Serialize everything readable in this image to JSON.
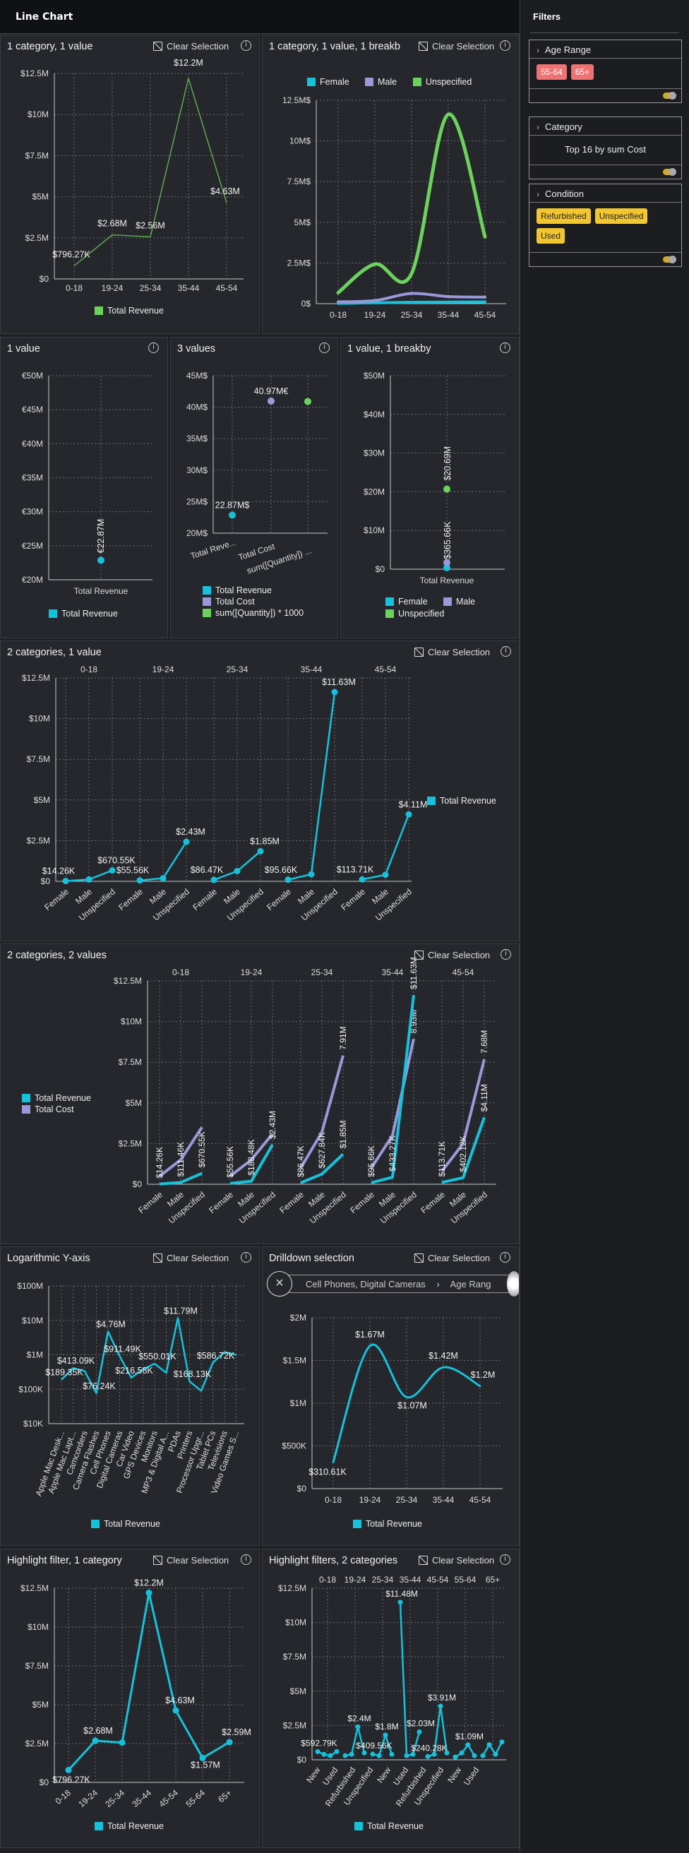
{
  "app": {
    "title": "Line Chart",
    "clear_label": "Clear Selection"
  },
  "panels": {
    "p1": {
      "title": "1 category, 1 value"
    },
    "p2": {
      "title": "1 category, 1 value, 1 breakb"
    },
    "p3": {
      "title": "1 value"
    },
    "p4": {
      "title": "3 values"
    },
    "p5": {
      "title": "1 value, 1 breakby"
    },
    "p6": {
      "title": "2 categories, 1 value"
    },
    "p7": {
      "title": "2 categories, 2 values"
    },
    "p8": {
      "title": "Logarithmic Y-axis"
    },
    "p9": {
      "title": "Drilldown selection",
      "breadcrumb": [
        "Cell Phones, Digital Cameras",
        "Age Rang"
      ]
    },
    "p10": {
      "title": "Highlight filter, 1 category"
    },
    "p11": {
      "title": "Highlight filters, 2 categories"
    }
  },
  "filters": {
    "title": "Filters",
    "age_range": {
      "label": "Age Range",
      "chips": [
        "55-64",
        "65+"
      ]
    },
    "category": {
      "label": "Category",
      "text": "Top 16 by sum Cost"
    },
    "condition": {
      "label": "Condition",
      "chips": [
        "Refurbished",
        "Unspecified",
        "Used"
      ]
    }
  },
  "colors": {
    "cyan": "#15c2dc",
    "purple": "#9a98d9",
    "green": "#6bd35c",
    "line_green": "#5da84f",
    "grid": "#6a6b70",
    "axis": "#c8c8c8"
  },
  "chart_data": [
    {
      "id": "p1",
      "type": "line",
      "categories": [
        "0-18",
        "19-24",
        "25-34",
        "35-44",
        "45-54"
      ],
      "series": [
        {
          "name": "Total Revenue",
          "values": [
            796270,
            2680000,
            2560000,
            12200000,
            4630000
          ],
          "labels": [
            "$796.27K",
            "$2.68M",
            "$2.56M",
            "$12.2M",
            "$4.63M"
          ]
        }
      ],
      "y_ticks": [
        "$0",
        "$2.5M",
        "$5M",
        "$7.5M",
        "$10M",
        "$12.5M"
      ],
      "ylim": [
        0,
        12500000
      ]
    },
    {
      "id": "p2",
      "type": "line",
      "categories": [
        "0-18",
        "19-24",
        "25-34",
        "35-44",
        "45-54"
      ],
      "series": [
        {
          "name": "Female",
          "values": [
            14260,
            55560,
            86470,
            95660,
            113710
          ]
        },
        {
          "name": "Male",
          "values": [
            111460,
            188480,
            627840,
            433270,
            402120
          ]
        },
        {
          "name": "Unspecified",
          "values": [
            670550,
            2430000,
            1850000,
            11630000,
            4110000
          ]
        }
      ],
      "y_ticks": [
        "0$",
        "2.5M$",
        "5M$",
        "7.5M$",
        "10M$",
        "12.5M$"
      ],
      "ylim": [
        0,
        12500000
      ]
    },
    {
      "id": "p3",
      "type": "scatter",
      "categories": [
        "Total Revenue"
      ],
      "series": [
        {
          "name": "Total Revenue",
          "values": [
            22.87
          ],
          "labels": [
            "€22.87M"
          ]
        }
      ],
      "y_ticks": [
        "€20M",
        "€25M",
        "€30M",
        "€35M",
        "€40M",
        "€45M",
        "€50M"
      ],
      "ylim": [
        20,
        50
      ]
    },
    {
      "id": "p4",
      "type": "scatter",
      "categories": [
        "Total Reve...",
        "Total Cost",
        "sum([Quantity]) ..."
      ],
      "series": [
        {
          "name": "Total Revenue",
          "values": [
            22.87
          ],
          "labels": [
            "22.87M$"
          ]
        },
        {
          "name": "Total Cost",
          "values": [
            40.97
          ],
          "labels": [
            "40.97M€"
          ]
        },
        {
          "name": "sum([Quantity]) * 1000",
          "values": [
            40.9
          ]
        }
      ],
      "y_ticks": [
        "20M$",
        "25M$",
        "30M$",
        "35M$",
        "40M$",
        "45M$"
      ],
      "ylim": [
        20,
        45
      ]
    },
    {
      "id": "p5",
      "type": "scatter",
      "categories": [
        "Total Revenue"
      ],
      "series": [
        {
          "name": "Female",
          "values": [
            0.366
          ],
          "labels": [
            "$365.66K"
          ]
        },
        {
          "name": "Male",
          "values": [
            1.7
          ]
        },
        {
          "name": "Unspecified",
          "values": [
            20.69
          ],
          "labels": [
            "$20.69M"
          ]
        }
      ],
      "y_ticks": [
        "$0",
        "$10M",
        "$20M",
        "$30M",
        "$40M",
        "$50M"
      ],
      "ylim": [
        0,
        50
      ]
    },
    {
      "id": "p6",
      "type": "line",
      "groups": [
        "0-18",
        "19-24",
        "25-34",
        "35-44",
        "45-54"
      ],
      "subcategories": [
        "Female",
        "Male",
        "Unspecified"
      ],
      "series": [
        {
          "name": "Total Revenue",
          "values": [
            [
              14260,
              111460,
              670550
            ],
            [
              55560,
              188480,
              2430000
            ],
            [
              86470,
              627840,
              1850000
            ],
            [
              95660,
              433270,
              11630000
            ],
            [
              113710,
              402120,
              4110000
            ]
          ],
          "labels": [
            [
              "$14.26K",
              "",
              "$670.55K"
            ],
            [
              "$55.56K",
              "",
              "$2.43M"
            ],
            [
              "$86.47K",
              "",
              "$1.85M"
            ],
            [
              "$95.66K",
              "",
              "$11.63M"
            ],
            [
              "$113.71K",
              "",
              "$4.11M"
            ]
          ]
        }
      ],
      "y_ticks": [
        "$0",
        "$2.5M",
        "$5M",
        "$7.5M",
        "$10M",
        "$12.5M"
      ],
      "ylim": [
        0,
        12500000
      ]
    },
    {
      "id": "p7",
      "type": "line",
      "groups": [
        "0-18",
        "19-24",
        "25-34",
        "35-44",
        "45-54"
      ],
      "subcategories": [
        "Female",
        "Male",
        "Unspecified"
      ],
      "series": [
        {
          "name": "Total Revenue",
          "values": [
            [
              14260,
              111460,
              670550
            ],
            [
              55560,
              188480,
              2430000
            ],
            [
              86470,
              627840,
              1850000
            ],
            [
              95660,
              433270,
              11630000
            ],
            [
              113710,
              402120,
              4110000
            ]
          ],
          "labels": [
            [
              "$14.26K",
              "$111.46K",
              "$670.55K"
            ],
            [
              "$55.56K",
              "$188.48K",
              "$2.43M"
            ],
            [
              "$86.47K",
              "$627.84K",
              "$1.85M"
            ],
            [
              "$95.66K",
              "$433.27K",
              "$11.63M"
            ],
            [
              "$113.71K",
              "$402.12K",
              "$4.11M"
            ]
          ]
        },
        {
          "name": "Total Cost",
          "values": [
            [
              500000,
              1500000,
              3500000
            ],
            [
              500000,
              1500000,
              3100000
            ],
            [
              1000000,
              3200000,
              7910000
            ],
            [
              1000000,
              3000000,
              8930000
            ],
            [
              800000,
              2500000,
              7680000
            ]
          ],
          "labels": [
            [
              "",
              "",
              ""
            ],
            [
              "",
              "",
              ""
            ],
            [
              "",
              "",
              "7.91M"
            ],
            [
              "",
              "",
              "8.93M"
            ],
            [
              "",
              "",
              "7.68M"
            ]
          ]
        }
      ],
      "y_ticks": [
        "$0",
        "$2.5M",
        "$5M",
        "$7.5M",
        "$10M",
        "$12.5M"
      ],
      "ylim": [
        0,
        12500000
      ]
    },
    {
      "id": "p8",
      "type": "line",
      "scale": "log",
      "categories": [
        "Apple Mac Desk...",
        "Apple Mac Lapt...",
        "Camcorders",
        "Camera Flashes",
        "Cell Phones",
        "Digital Cameras",
        "Car Video",
        "GPS Devices",
        "Monitors",
        "MP3 & Digital A...",
        "PDAs",
        "Printers",
        "Processor Upgr...",
        "Tablet PCs",
        "Televisions",
        "Video Games S..."
      ],
      "series": [
        {
          "name": "Total Revenue",
          "values": [
            189350,
            413090,
            335000,
            76240,
            4760000,
            911490,
            216580,
            380000,
            550010,
            300000,
            11790000,
            168130,
            90000,
            586720,
            1200000,
            1000000
          ],
          "labels": [
            "$189.35K",
            "$413.09K",
            "",
            "$76.24K",
            "$4.76M",
            "$911.49K",
            "$216.58K",
            "",
            "$550.01K",
            "",
            "$11.79M",
            "$168.13K",
            "",
            "$586.72K",
            "",
            ""
          ]
        }
      ],
      "y_ticks": [
        "$10K",
        "$100K",
        "$1M",
        "$10M",
        "$100M"
      ]
    },
    {
      "id": "p9",
      "type": "line",
      "categories": [
        "0-18",
        "19-24",
        "25-34",
        "35-44",
        "45-54"
      ],
      "series": [
        {
          "name": "Total Revenue",
          "values": [
            310610,
            1670000,
            1070000,
            1420000,
            1200000
          ],
          "labels": [
            "$310.61K",
            "$1.67M",
            "$1.07M",
            "$1.42M",
            "$1.2M"
          ]
        }
      ],
      "y_ticks": [
        "$0",
        "$500K",
        "$1M",
        "$1.5M",
        "$2M"
      ],
      "ylim": [
        0,
        2000000
      ]
    },
    {
      "id": "p10",
      "type": "line",
      "categories": [
        "0-18",
        "19-24",
        "25-34",
        "35-44",
        "45-54",
        "55-64",
        "65+"
      ],
      "series": [
        {
          "name": "Total Revenue",
          "values": [
            796270,
            2680000,
            2560000,
            12200000,
            4630000,
            1570000,
            2590000
          ],
          "labels": [
            "$796.27K",
            "$2.68M",
            "",
            "$12.2M",
            "$4.63M",
            "$1.57M",
            "$2.59M"
          ]
        }
      ],
      "y_ticks": [
        "$0",
        "$2.5M",
        "$5M",
        "$7.5M",
        "$10M",
        "$12.5M"
      ],
      "ylim": [
        0,
        12500000
      ]
    },
    {
      "id": "p11",
      "type": "line",
      "groups": [
        "0-18",
        "19-24",
        "25-34",
        "35-44",
        "45-54",
        "55-64",
        "65+"
      ],
      "subcategories": [
        "New",
        "Used",
        "Refurbished",
        "Unspecified"
      ],
      "series": [
        {
          "name": "Total Revenue",
          "values": [
            [
              592790,
              400000,
              300000,
              600000
            ],
            [
              300000,
              400000,
              2400000,
              500000
            ],
            [
              409560,
              300000,
              1800000,
              400000
            ],
            [
              11480000,
              300000,
              400000,
              2030000
            ],
            [
              240280,
              400000,
              3910000,
              500000
            ],
            [
              200000,
              500000,
              1090000,
              300000
            ],
            [
              300000,
              1100000,
              400000,
              1300000
            ]
          ],
          "labels": [
            [
              "$592.79K",
              "",
              "",
              ""
            ],
            [
              "",
              "",
              "$2.4M",
              ""
            ],
            [
              "$409.56K",
              "",
              "$1.8M",
              ""
            ],
            [
              "$11.48M",
              "",
              "",
              "$2.03M"
            ],
            [
              "$240.28K",
              "",
              "$3.91M",
              ""
            ],
            [
              "",
              "",
              "$1.09M",
              ""
            ],
            [
              "",
              "",
              "",
              ""
            ]
          ]
        }
      ],
      "x_labels": [
        "New",
        "Used",
        "Refurbished",
        "Unspecified",
        "New",
        "Used",
        "Refurbished",
        "Unspecified",
        "New",
        "Used"
      ],
      "y_ticks": [
        "$0",
        "$2.5M",
        "$5M",
        "$7.5M",
        "$10M",
        "$12.5M"
      ],
      "ylim": [
        0,
        12500000
      ]
    }
  ]
}
